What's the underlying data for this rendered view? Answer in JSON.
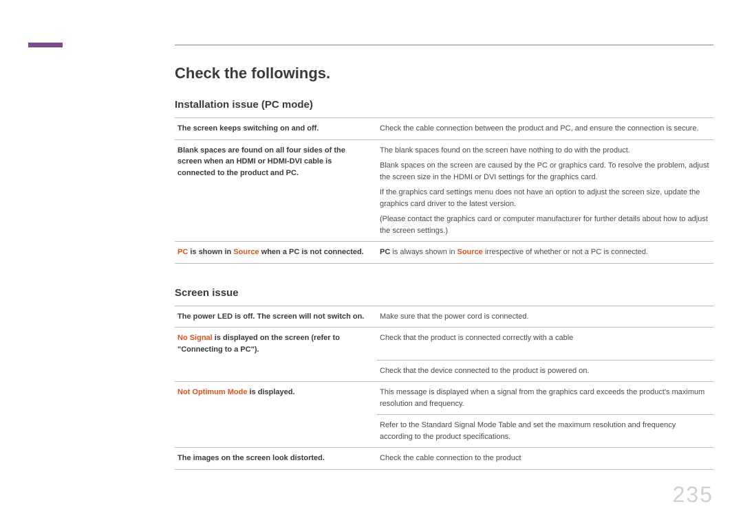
{
  "page_number": "235",
  "main_title": "Check the followings.",
  "section1": {
    "title": "Installation issue (PC mode)",
    "rows": [
      {
        "left": "The screen keeps switching on and off.",
        "right": [
          "Check the cable connection between the product and PC, and ensure the connection is secure."
        ]
      },
      {
        "left": "Blank spaces are found on all four sides of the screen when an HDMI or HDMI-DVI cable is connected to the product and PC.",
        "right": [
          "The blank spaces found on the screen have nothing to do with the product.",
          "Blank spaces on the screen are caused by the PC or graphics card. To resolve the problem, adjust the screen size in the HDMI or DVI settings for the graphics card.",
          "If the graphics card settings menu does not have an option to adjust the screen size, update the graphics card driver to the latest version.",
          "(Please contact the graphics card or computer manufacturer for further details about how to adjust the screen settings.)"
        ]
      },
      {
        "left_parts": [
          {
            "text": "PC",
            "hl": true
          },
          {
            "text": " is shown in ",
            "hl": false
          },
          {
            "text": "Source",
            "hl": true
          },
          {
            "text": " when a PC is not connected.",
            "hl": false
          }
        ],
        "right_parts": [
          {
            "text": "PC",
            "b": true
          },
          {
            "text": " is always shown in "
          },
          {
            "text": "Source",
            "hl": true
          },
          {
            "text": " irrespective of whether or not a PC is connected."
          }
        ]
      }
    ]
  },
  "section2": {
    "title": "Screen issue",
    "rows": [
      {
        "left": "The power LED is off. The screen will not switch on.",
        "right": [
          "Make sure that the power cord is connected."
        ]
      },
      {
        "left_parts": [
          {
            "text": "No Signal",
            "hl": true
          },
          {
            "text": " is displayed on the screen (refer to \"Connecting to a PC\").",
            "hl": false
          }
        ],
        "right": [
          "Check that the product is connected correctly with a cable"
        ]
      },
      {
        "left_noborder": true,
        "right": [
          "Check that the device connected to the product is powered on."
        ]
      },
      {
        "left_parts": [
          {
            "text": "Not Optimum Mode",
            "hl": true
          },
          {
            "text": " is displayed.",
            "hl": false
          }
        ],
        "right": [
          "This message is displayed when a signal from the graphics card exceeds the product's maximum resolution and frequency."
        ]
      },
      {
        "left_noborder": true,
        "right": [
          "Refer to the Standard Signal Mode Table and set the maximum resolution and frequency according to the product specifications."
        ]
      },
      {
        "left": "The images on the screen look distorted.",
        "right": [
          "Check the cable connection to the product"
        ]
      }
    ]
  }
}
